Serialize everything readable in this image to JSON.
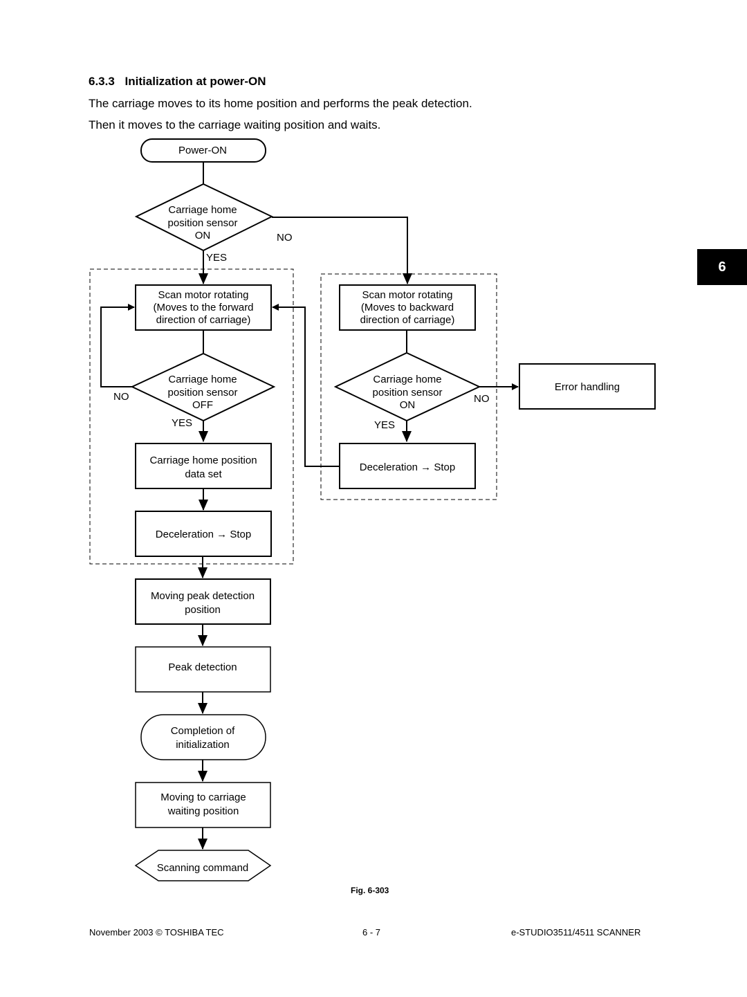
{
  "section": {
    "number": "6.3.3",
    "title": "Initialization at power-ON"
  },
  "paragraphs": [
    "The carriage moves to its home position and performs the peak detection.",
    "Then it moves to the carriage waiting position and waits."
  ],
  "chapter_tab": "6",
  "flowchart": {
    "power_on": "Power-ON",
    "decision_top": [
      "Carriage home",
      "position sensor",
      "ON"
    ],
    "decision_top_no": "NO",
    "decision_top_yes": "YES",
    "left_motor": [
      "Scan motor rotating",
      "(Moves to the forward",
      "direction of carriage)"
    ],
    "left_decision": [
      "Carriage home",
      "position sensor",
      "OFF"
    ],
    "left_decision_no": "NO",
    "left_decision_yes": "YES",
    "home_data_set": [
      "Carriage home position",
      "data set"
    ],
    "left_decel": "Deceleration → Stop",
    "right_motor": [
      "Scan motor rotating",
      "(Moves to backward",
      "direction of carriage)"
    ],
    "right_decision": [
      "Carriage home",
      "position sensor",
      "ON"
    ],
    "right_decision_no": "NO",
    "right_decision_yes": "YES",
    "error_handling": "Error handling",
    "right_decel": "Deceleration → Stop",
    "moving_peak": [
      "Moving peak detection",
      "position"
    ],
    "peak_detection": "Peak detection",
    "completion": [
      "Completion of",
      "initialization"
    ],
    "moving_waiting": [
      "Moving to carriage",
      "waiting position"
    ],
    "scanning_command": "Scanning command"
  },
  "figure_caption": "Fig. 6-303",
  "footer": {
    "left": "November 2003 © TOSHIBA TEC",
    "center": "6 - 7",
    "right": "e-STUDIO3511/4511 SCANNER"
  }
}
